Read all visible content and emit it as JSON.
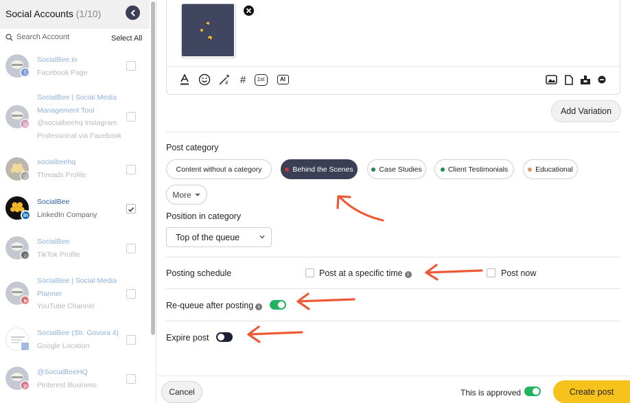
{
  "sidebar": {
    "title": "Social Accounts",
    "count": "(1/10)",
    "search_placeholder": "Search Account",
    "select_all": "Select All",
    "accounts": [
      {
        "name1": "SocialBee.io",
        "name2": "",
        "sub1": "Facebook Page",
        "sub2": "",
        "network": "facebook",
        "checked": false
      },
      {
        "name1": "SocialBee | Social Media",
        "name2": "Management Tool",
        "sub1": "@socialbeehq Instagram",
        "sub2": "Professional via Facebook",
        "network": "instagram",
        "checked": false
      },
      {
        "name1": "socialbeehq",
        "name2": "",
        "sub1": "Threads Profile",
        "sub2": "",
        "network": "threads",
        "checked": false
      },
      {
        "name1": "SocialBee",
        "name2": "",
        "sub1": "LinkedIn Company",
        "sub2": "",
        "network": "linkedin",
        "checked": true
      },
      {
        "name1": "SocialBee",
        "name2": "",
        "sub1": "TikTok Profile",
        "sub2": "",
        "network": "tiktok",
        "checked": false
      },
      {
        "name1": "SocialBee | Social Media",
        "name2": "Planner",
        "sub1": "YouTube Channel",
        "sub2": "",
        "network": "youtube",
        "checked": false
      },
      {
        "name1": "SocialBee (Str. Govora 4)",
        "name2": "",
        "sub1": "Google Location",
        "sub2": "",
        "network": "google",
        "checked": false
      },
      {
        "name1": "@SocialBeeHQ",
        "name2": "",
        "sub1": "Pinterest Business",
        "sub2": "",
        "network": "pinterest",
        "checked": false
      }
    ]
  },
  "editor": {
    "toolbar_left": [
      "text-format-icon",
      "emoji-icon",
      "magic-hashtag-icon",
      "hashtag-icon",
      "first-comment-icon",
      "ai-icon"
    ],
    "toolbar_right": [
      "image-icon",
      "document-icon",
      "canva-icon",
      "more-icon"
    ],
    "first_comment_label": "1st",
    "ai_label": "AI",
    "hashtag_label": "#",
    "add_variation": "Add Variation"
  },
  "category": {
    "label": "Post category",
    "pills": [
      {
        "label": "Content without a category",
        "color": "",
        "selected": false
      },
      {
        "label": "Behind the Scenes",
        "color": "#c0392b",
        "selected": true
      },
      {
        "label": "Case Studies",
        "color": "#1e8a4c",
        "selected": false
      },
      {
        "label": "Client Testimonials",
        "color": "#1e8a4c",
        "selected": false
      },
      {
        "label": "Educational",
        "color": "#d89a5b",
        "selected": false
      }
    ],
    "more": "More"
  },
  "position": {
    "label": "Position in category",
    "value": "Top of the queue"
  },
  "schedule": {
    "label": "Posting schedule",
    "specific_time": "Post at a specific time",
    "post_now": "Post now"
  },
  "requeue": {
    "label": "Re-queue after posting",
    "enabled": true
  },
  "expire": {
    "label": "Expire post",
    "enabled": false
  },
  "footer": {
    "cancel": "Cancel",
    "approved_label": "This is approved",
    "approved": true,
    "create": "Create post"
  },
  "colors": {
    "accent_dark": "#3b3f55",
    "toggle_on": "#22b35e",
    "create_button": "#f7c21b",
    "arrow": "#ef5a36"
  }
}
